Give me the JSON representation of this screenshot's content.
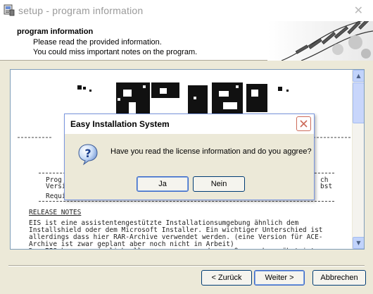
{
  "window": {
    "title": "setup - program information",
    "close_glyph": "✕",
    "app_icon": "setup-icon"
  },
  "header": {
    "title": "program information",
    "line1": "Please read the provided information.",
    "line2": "You could miss important notes on the program."
  },
  "content": {
    "info_left_1": "Prog",
    "info_left_2": "Versi",
    "info_right_1": "ch",
    "info_right_2": "bst",
    "requirements": "Requi",
    "release_title": "RELEASE NOTES",
    "release_body": "EIS ist eine assistentengestützte Installationsumgebung ähnlich dem\nInstallshield oder dem Microsoft Installer. Ein wichtiger Unterschied ist\nallerdings dass hier RAR-Archive verwendet werden. (eine Version für ACE-\nArchive ist zwar geplant aber noch nicht in Arbeit)\nDas EIS kann so ziemlich alles, was man von den großen auch gewöhnt ist"
  },
  "footer": {
    "back": "< Zurück",
    "next": "Weiter >",
    "cancel": "Abbrechen"
  },
  "dialog": {
    "title": "Easy Installation System",
    "question": "Have you read the license information and do you aggree?",
    "yes": "Ja",
    "no": "Nein",
    "icon": "question-icon"
  },
  "colors": {
    "dialog_border": "#7a96df",
    "close_button": "#cc6b5a",
    "face": "#ece9d8"
  }
}
